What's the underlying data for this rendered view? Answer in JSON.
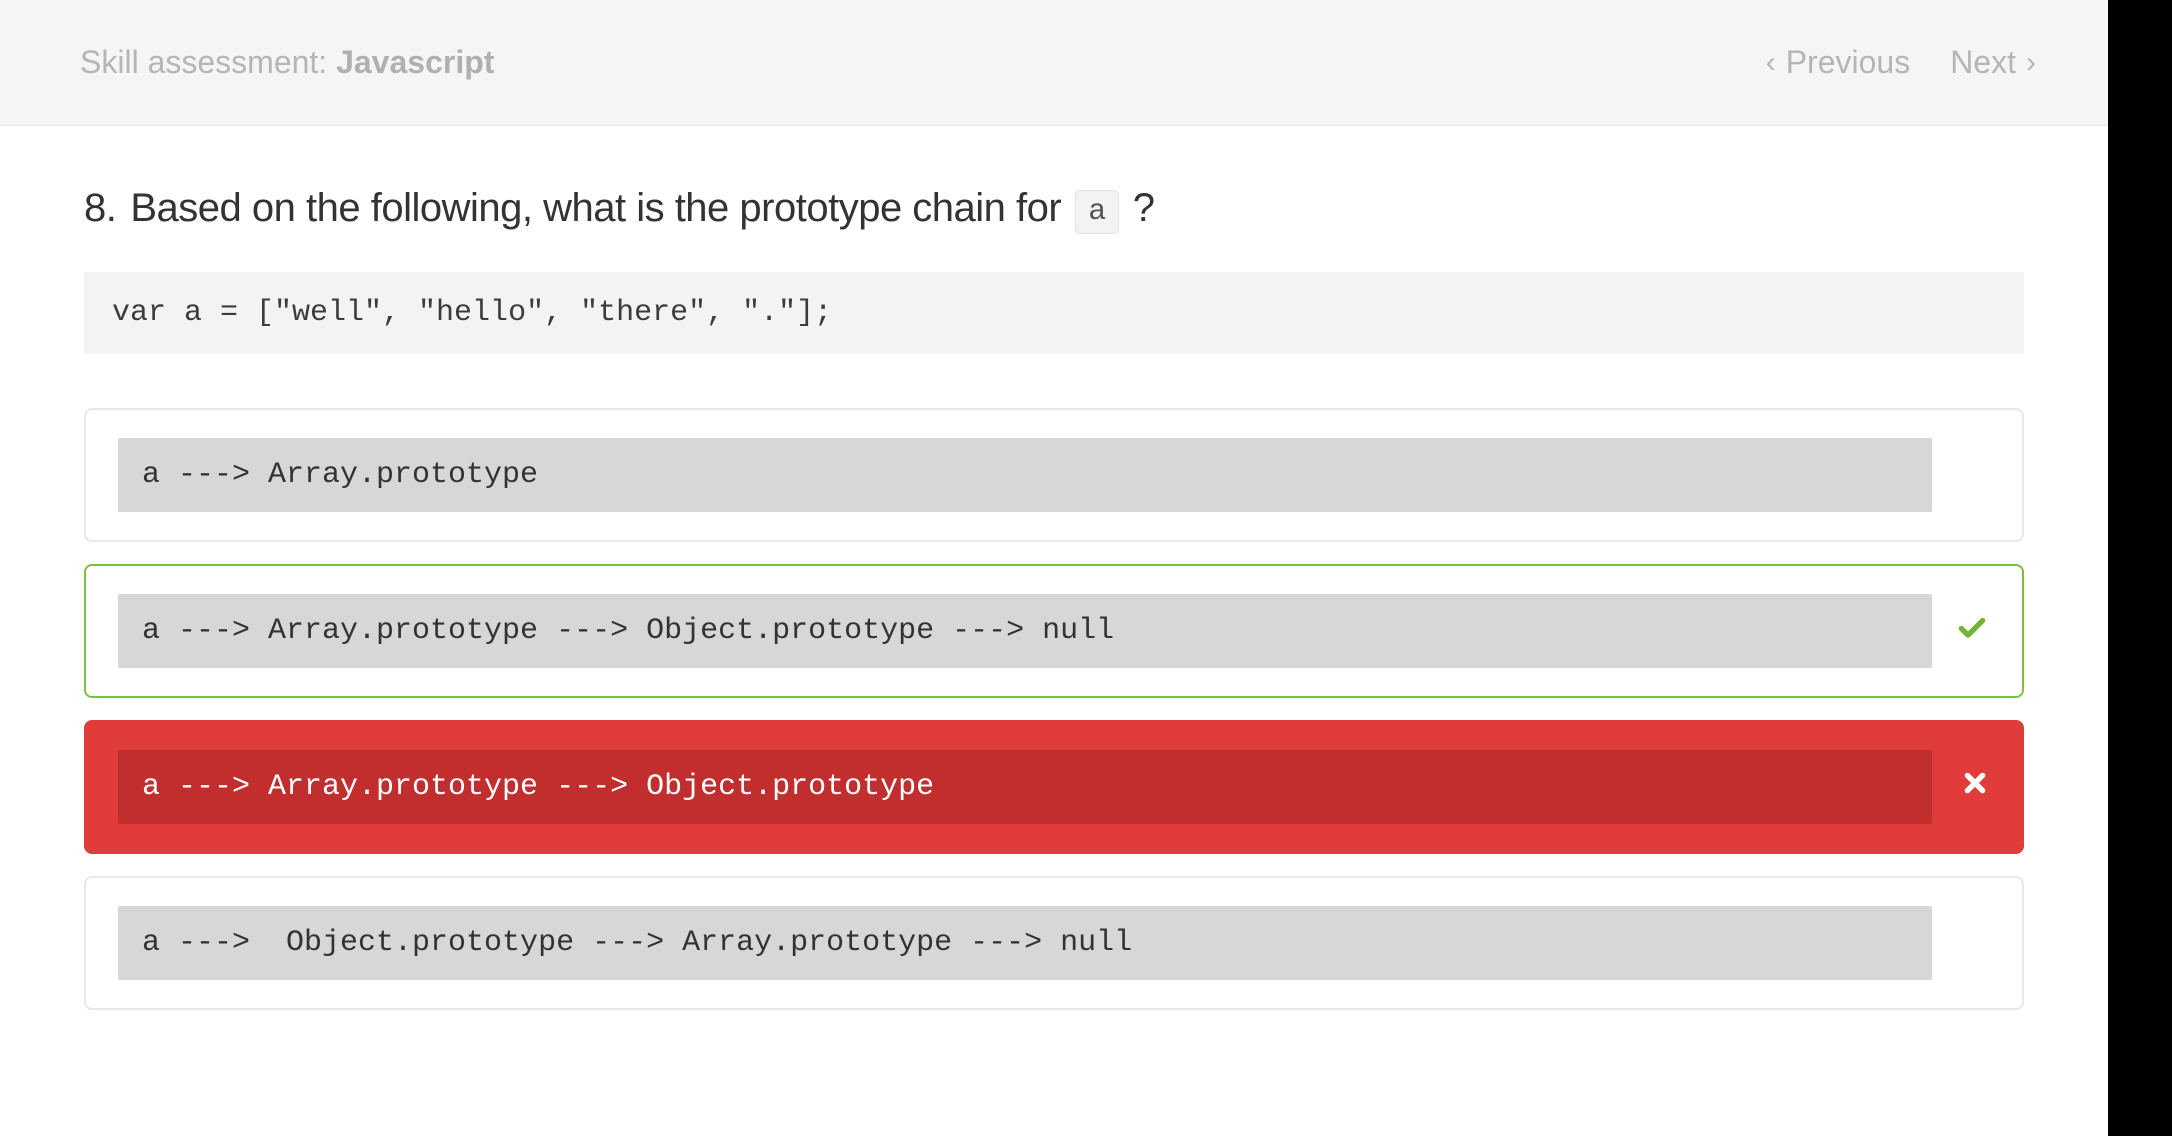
{
  "header": {
    "label_prefix": "Skill assessment: ",
    "label_bold": "Javascript",
    "prev": "Previous",
    "next": "Next"
  },
  "question": {
    "number": "8.",
    "text": "Based on the following, what is the prototype chain for",
    "inline_code": "a",
    "suffix": "?"
  },
  "code": "var a = [\"well\", \"hello\", \"there\", \".\"];",
  "answers": [
    {
      "code": "a ---> Array.prototype",
      "state": "neutral"
    },
    {
      "code": "a ---> Array.prototype ---> Object.prototype ---> null",
      "state": "correct"
    },
    {
      "code": "a ---> Array.prototype ---> Object.prototype",
      "state": "wrong"
    },
    {
      "code": "a --->  Object.prototype ---> Array.prototype ---> null",
      "state": "neutral"
    }
  ]
}
